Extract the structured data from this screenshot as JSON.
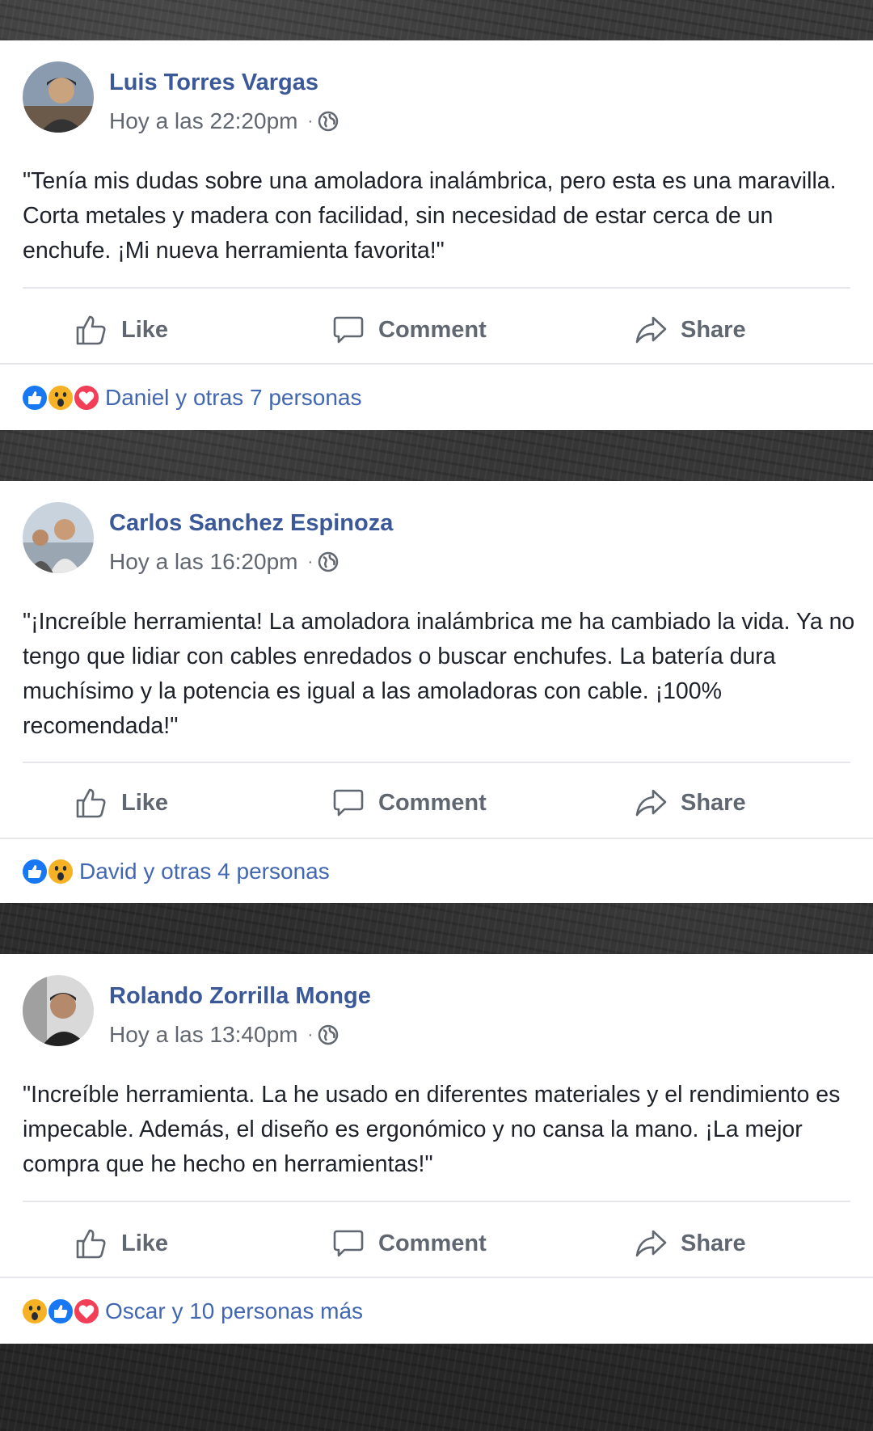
{
  "posts": [
    {
      "author": "Luis Torres Vargas",
      "time": "Hoy a las 22:20pm",
      "separator": "·",
      "text": "\"Tenía mis dudas sobre una amoladora inalámbrica, pero esta es una maravilla. Corta metales y madera con facilidad, sin necesidad de estar cerca de un enchufe. ¡Mi nueva herramienta favorita!\"",
      "actions": {
        "like": "Like",
        "comment": "Comment",
        "share": "Share"
      },
      "reaction_icons": [
        "like-reaction-icon",
        "wow-reaction-icon",
        "love-reaction-icon"
      ],
      "reaction_text": "Daniel y otras 7 personas"
    },
    {
      "author": "Carlos Sanchez Espinoza",
      "time": "Hoy a las 16:20pm",
      "separator": "·",
      "text": "\"¡Increíble herramienta! La amoladora inalámbrica me ha cambiado la vida. Ya no tengo que lidiar con cables enredados o buscar enchufes. La batería dura muchísimo y la potencia es igual a las amoladoras con cable. ¡100% recomendada!\"",
      "actions": {
        "like": "Like",
        "comment": "Comment",
        "share": "Share"
      },
      "reaction_icons": [
        "like-reaction-icon",
        "wow-reaction-icon"
      ],
      "reaction_text": "David y otras 4 personas"
    },
    {
      "author": "Rolando Zorrilla Monge",
      "time": "Hoy a las 13:40pm",
      "separator": "·",
      "text": "\"Increíble herramienta. La he usado en diferentes materiales y el rendimiento es impecable. Además, el diseño es ergonómico y no cansa la mano. ¡La mejor compra que he hecho en herramientas!\"",
      "actions": {
        "like": "Like",
        "comment": "Comment",
        "share": "Share"
      },
      "reaction_icons": [
        "wow-reaction-icon",
        "like-reaction-icon",
        "love-reaction-icon"
      ],
      "reaction_text": "Oscar y 10 personas más"
    }
  ],
  "colors": {
    "author": "#3b5998",
    "link": "#4267b2",
    "body_text": "#1d2129",
    "meta": "#616770",
    "like_blue": "#1877f2",
    "love_red": "#f33e58",
    "wow_yellow": "#f7b125"
  }
}
